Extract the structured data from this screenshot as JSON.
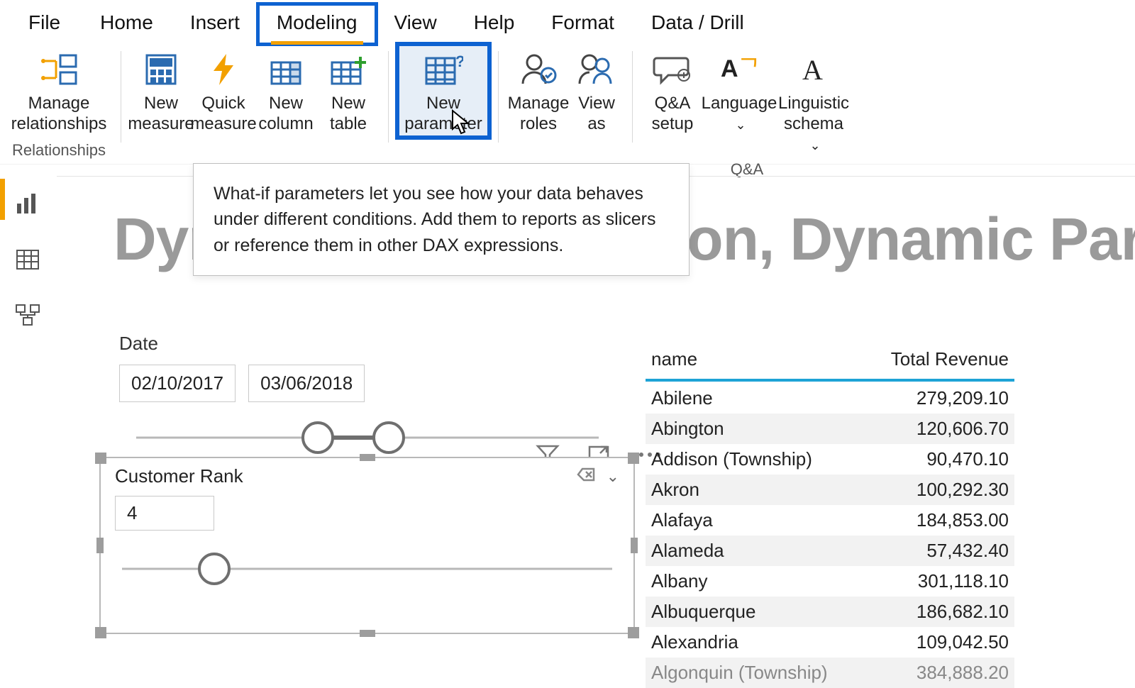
{
  "tabs": {
    "file": "File",
    "home": "Home",
    "insert": "Insert",
    "modeling": "Modeling",
    "view": "View",
    "help": "Help",
    "format": "Format",
    "datadrill": "Data / Drill"
  },
  "ribbon": {
    "manage_relationships": "Manage\nrelationships",
    "new_measure": "New\nmeasure",
    "quick_measure": "Quick\nmeasure",
    "new_column": "New\ncolumn",
    "new_table": "New\ntable",
    "new_parameter": "New\nparameter",
    "manage_roles": "Manage\nroles",
    "view_as": "View\nas",
    "qna_setup": "Q&A\nsetup",
    "language": "Language",
    "linguistic_schema": "Linguistic\nschema"
  },
  "groups": {
    "relationships": "Relationships",
    "qna": "Q&A"
  },
  "tooltip": "What-if parameters let you see how your data behaves under different conditions. Add them to reports as slicers or reference them in other DAX expressions.",
  "page_title": "Dynamic Segmentation, Dynamic Para",
  "date": {
    "label": "Date",
    "from": "02/10/2017",
    "to": "03/06/2018"
  },
  "rank": {
    "title": "Customer Rank",
    "value": "4"
  },
  "table": {
    "cols": [
      "name",
      "Total Revenue"
    ],
    "rows": [
      {
        "n": "Abilene",
        "v": "279,209.10"
      },
      {
        "n": "Abington",
        "v": "120,606.70"
      },
      {
        "n": "Addison (Township)",
        "v": "90,470.10"
      },
      {
        "n": "Akron",
        "v": "100,292.30"
      },
      {
        "n": "Alafaya",
        "v": "184,853.00"
      },
      {
        "n": "Alameda",
        "v": "57,432.40"
      },
      {
        "n": "Albany",
        "v": "301,118.10"
      },
      {
        "n": "Albuquerque",
        "v": "186,682.10"
      },
      {
        "n": "Alexandria",
        "v": "109,042.50"
      },
      {
        "n": "Algonquin (Township)",
        "v": "384,888.20"
      }
    ]
  }
}
